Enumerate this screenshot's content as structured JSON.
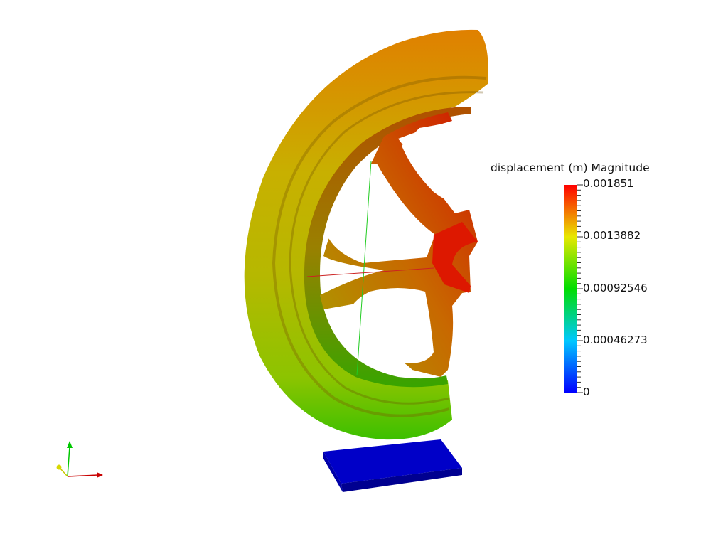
{
  "colors": {
    "background": "#ffffff",
    "colormap": [
      "#0000ff",
      "#00ffff",
      "#00ff00",
      "#ffff00",
      "#ff0000"
    ],
    "support_plate": "#0000c8",
    "axis_x": "#c80000",
    "axis_y": "#00c800",
    "axis_z": "#c8c800"
  },
  "scalar_bar": {
    "title": "displacement (m) Magnitude",
    "labels": [
      "0.001851",
      "0.0013882",
      "0.00092546",
      "0.00046273",
      "0"
    ]
  },
  "orientation_axes": {
    "axes": [
      "x-axis-arrow",
      "y-axis-arrow",
      "z-axis-arrow"
    ]
  },
  "scene": {
    "objects": [
      "wheel-model",
      "support-plate"
    ]
  }
}
